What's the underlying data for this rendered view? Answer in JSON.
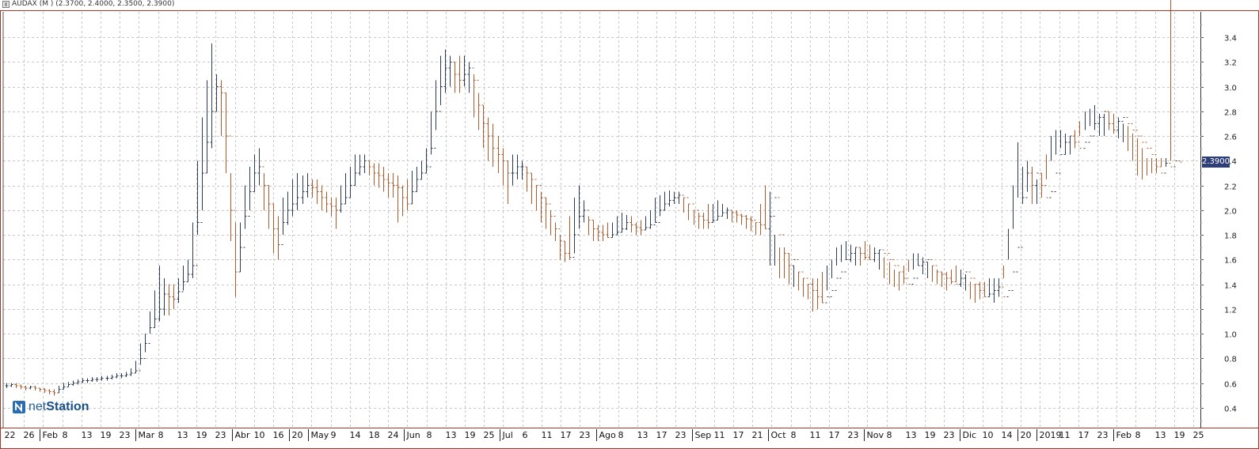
{
  "window": {
    "title": "AUDAX (M ) (2.3700, 2.4000, 2.3500, 2.3900)"
  },
  "logo": {
    "text_prefix": "net",
    "text_suffix": "Station",
    "icon": "netstation-logo-icon"
  },
  "colors": {
    "up": "#2b3a55",
    "down": "#b05a2c",
    "grid": "#c8c8c8",
    "frame": "#a03a2a",
    "badge": "#2e3f78"
  },
  "chart_data": {
    "type": "ohlc",
    "ylim": [
      0.3,
      3.6
    ],
    "yticks": [
      "0.4",
      "0.6",
      "0.8",
      "1.0",
      "1.2",
      "1.4",
      "1.6",
      "1.8",
      "2.0",
      "2.2",
      "2.4",
      "2.6",
      "2.8",
      "3.0",
      "3.2",
      "3.4"
    ],
    "last_price": "2.3900",
    "xticks": [
      "22",
      "26",
      "Feb",
      "8",
      "13",
      "19",
      "23",
      "Mar",
      "8",
      "13",
      "19",
      "23",
      "Abr",
      "10",
      "16",
      "20",
      "May",
      "9",
      "14",
      "18",
      "24",
      "Jun",
      "8",
      "13",
      "19",
      "25",
      "Jul",
      "6",
      "11",
      "17",
      "23",
      "Ago",
      "8",
      "13",
      "17",
      "23",
      "Sep",
      "11",
      "17",
      "21",
      "Oct",
      "8",
      "11",
      "17",
      "23",
      "Nov",
      "8",
      "13",
      "19",
      "23",
      "Dic",
      "10",
      "14",
      "20",
      "2019",
      "11",
      "17",
      "23",
      "Feb",
      "8",
      "13",
      "19",
      "25"
    ],
    "grid": true,
    "close": [
      0.58,
      0.59,
      0.58,
      0.57,
      0.56,
      0.57,
      0.56,
      0.55,
      0.54,
      0.53,
      0.52,
      0.55,
      0.57,
      0.59,
      0.6,
      0.61,
      0.62,
      0.62,
      0.63,
      0.63,
      0.64,
      0.64,
      0.65,
      0.66,
      0.66,
      0.67,
      0.68,
      0.7,
      0.8,
      0.92,
      1.05,
      1.12,
      1.2,
      1.32,
      1.3,
      1.28,
      1.34,
      1.42,
      1.48,
      1.55,
      1.9,
      2.3,
      2.55,
      2.8,
      3.0,
      2.95,
      2.6,
      2.0,
      1.5,
      1.7,
      1.95,
      2.15,
      2.3,
      2.35,
      2.2,
      2.05,
      1.85,
      1.72,
      1.9,
      2.0,
      2.05,
      2.1,
      2.15,
      2.2,
      2.18,
      2.15,
      2.1,
      2.05,
      2.03,
      2.0,
      2.05,
      2.1,
      2.2,
      2.3,
      2.35,
      2.4,
      2.35,
      2.3,
      2.28,
      2.25,
      2.22,
      2.2,
      2.18,
      2.1,
      2.05,
      2.15,
      2.25,
      2.3,
      2.35,
      2.5,
      2.8,
      3.0,
      3.15,
      3.2,
      3.1,
      3.05,
      3.1,
      3.15,
      3.05,
      2.85,
      2.7,
      2.6,
      2.5,
      2.45,
      2.4,
      2.3,
      2.3,
      2.35,
      2.35,
      2.3,
      2.25,
      2.2,
      2.1,
      2.05,
      1.95,
      1.85,
      1.75,
      1.65,
      1.62,
      1.8,
      1.95,
      2.0,
      1.92,
      1.85,
      1.82,
      1.8,
      1.78,
      1.8,
      1.82,
      1.85,
      1.9,
      1.88,
      1.86,
      1.84,
      1.86,
      1.88,
      1.9,
      2.0,
      2.05,
      2.08,
      2.1,
      2.12,
      2.1,
      2.05,
      2.0,
      1.95,
      1.92,
      1.9,
      1.92,
      1.95,
      1.98,
      2.0,
      1.98,
      1.96,
      1.95,
      1.93,
      1.92,
      1.9,
      1.88,
      1.85,
      1.95,
      2.1,
      1.8,
      1.65,
      1.55,
      1.6,
      1.5,
      1.45,
      1.4,
      1.35,
      1.3,
      1.25,
      1.3,
      1.35,
      1.45,
      1.5,
      1.6,
      1.65,
      1.7,
      1.65,
      1.62,
      1.6,
      1.65,
      1.68,
      1.65,
      1.6,
      1.55,
      1.5,
      1.45,
      1.4,
      1.45,
      1.55,
      1.58,
      1.6,
      1.55,
      1.5,
      1.48,
      1.45,
      1.42,
      1.4,
      1.45,
      1.5,
      1.45,
      1.4,
      1.35,
      1.3,
      1.32,
      1.35,
      1.38,
      1.3,
      1.35,
      1.5,
      1.7,
      2.1,
      2.3,
      2.2,
      2.3,
      2.2,
      2.1,
      2.15,
      2.3,
      2.45,
      2.55,
      2.6,
      2.55,
      2.5,
      2.55,
      2.6,
      2.7,
      2.75,
      2.8,
      2.7,
      2.65,
      2.72,
      2.75,
      2.7,
      2.65,
      2.6,
      2.55,
      2.5,
      2.45,
      2.35,
      2.3,
      2.38,
      2.35,
      2.4,
      2.39
    ],
    "high": [
      0.6,
      0.6,
      0.6,
      0.59,
      0.58,
      0.58,
      0.58,
      0.56,
      0.56,
      0.55,
      0.55,
      0.58,
      0.6,
      0.61,
      0.62,
      0.63,
      0.64,
      0.64,
      0.65,
      0.65,
      0.66,
      0.66,
      0.67,
      0.68,
      0.68,
      0.69,
      0.72,
      0.78,
      0.92,
      1.0,
      1.18,
      1.35,
      1.55,
      1.45,
      1.4,
      1.4,
      1.45,
      1.55,
      1.6,
      1.9,
      2.4,
      2.75,
      3.05,
      3.35,
      3.1,
      3.05,
      2.95,
      2.3,
      1.9,
      1.9,
      2.2,
      2.35,
      2.45,
      2.5,
      2.3,
      2.2,
      2.05,
      1.95,
      2.1,
      2.15,
      2.25,
      2.3,
      2.28,
      2.3,
      2.25,
      2.25,
      2.2,
      2.15,
      2.1,
      2.1,
      2.2,
      2.3,
      2.35,
      2.45,
      2.45,
      2.45,
      2.4,
      2.38,
      2.38,
      2.35,
      2.3,
      2.3,
      2.28,
      2.2,
      2.25,
      2.32,
      2.35,
      2.4,
      2.5,
      2.8,
      3.05,
      3.25,
      3.3,
      3.25,
      3.2,
      3.25,
      3.25,
      3.2,
      3.1,
      2.95,
      2.85,
      2.75,
      2.7,
      2.6,
      2.5,
      2.4,
      2.45,
      2.45,
      2.4,
      2.35,
      2.3,
      2.2,
      2.15,
      2.1,
      2.0,
      1.9,
      1.8,
      1.75,
      1.95,
      2.1,
      2.2,
      2.08,
      1.95,
      1.92,
      1.88,
      1.88,
      1.9,
      1.9,
      1.95,
      1.98,
      1.96,
      1.95,
      1.9,
      1.92,
      1.95,
      2.0,
      2.1,
      2.12,
      2.15,
      2.16,
      2.15,
      2.15,
      2.1,
      2.05,
      2.0,
      1.98,
      1.98,
      2.05,
      2.05,
      2.08,
      2.05,
      2.02,
      2.0,
      2.0,
      1.97,
      1.96,
      1.95,
      1.9,
      2.05,
      2.2,
      2.15,
      1.8,
      1.7,
      1.7,
      1.65,
      1.55,
      1.5,
      1.45,
      1.4,
      1.45,
      1.45,
      1.5,
      1.55,
      1.6,
      1.7,
      1.72,
      1.75,
      1.72,
      1.7,
      1.7,
      1.75,
      1.72,
      1.7,
      1.68,
      1.62,
      1.58,
      1.52,
      1.5,
      1.55,
      1.6,
      1.65,
      1.65,
      1.62,
      1.58,
      1.55,
      1.52,
      1.5,
      1.5,
      1.52,
      1.55,
      1.52,
      1.48,
      1.42,
      1.4,
      1.42,
      1.42,
      1.45,
      1.45,
      1.45,
      1.55,
      1.85,
      2.2,
      2.55,
      2.35,
      2.4,
      2.35,
      2.25,
      2.3,
      2.45,
      2.6,
      2.65,
      2.65,
      2.62,
      2.6,
      2.65,
      2.72,
      2.8,
      2.82,
      2.85,
      2.78,
      2.78,
      2.8,
      2.78,
      2.75,
      2.7,
      2.68,
      2.62,
      2.58,
      2.5,
      2.42,
      2.42,
      2.42,
      2.42,
      2.42,
      2.4
    ],
    "low": [
      0.56,
      0.57,
      0.56,
      0.55,
      0.54,
      0.55,
      0.54,
      0.53,
      0.52,
      0.51,
      0.5,
      0.52,
      0.55,
      0.57,
      0.58,
      0.59,
      0.6,
      0.6,
      0.61,
      0.61,
      0.62,
      0.62,
      0.63,
      0.64,
      0.64,
      0.65,
      0.66,
      0.68,
      0.75,
      0.85,
      1.0,
      1.05,
      1.1,
      1.15,
      1.15,
      1.2,
      1.25,
      1.35,
      1.42,
      1.45,
      1.8,
      2.0,
      2.3,
      2.5,
      2.8,
      2.6,
      2.3,
      1.75,
      1.3,
      1.5,
      1.85,
      2.0,
      2.15,
      2.2,
      2.0,
      1.85,
      1.65,
      1.6,
      1.8,
      1.88,
      1.95,
      2.0,
      2.05,
      2.1,
      2.1,
      2.05,
      2.0,
      1.98,
      1.95,
      1.85,
      1.98,
      2.05,
      2.1,
      2.2,
      2.28,
      2.3,
      2.28,
      2.2,
      2.18,
      2.15,
      2.1,
      2.1,
      1.9,
      1.95,
      2.0,
      2.05,
      2.15,
      2.25,
      2.3,
      2.45,
      2.65,
      2.85,
      2.95,
      3.0,
      2.95,
      2.95,
      3.0,
      2.95,
      2.75,
      2.65,
      2.5,
      2.4,
      2.35,
      2.3,
      2.2,
      2.05,
      2.2,
      2.25,
      2.25,
      2.15,
      2.05,
      2.0,
      1.9,
      1.85,
      1.8,
      1.75,
      1.6,
      1.58,
      1.6,
      1.65,
      1.85,
      1.9,
      1.8,
      1.75,
      1.75,
      1.75,
      1.78,
      1.78,
      1.8,
      1.82,
      1.84,
      1.82,
      1.8,
      1.8,
      1.84,
      1.85,
      1.9,
      1.95,
      2.0,
      2.03,
      2.05,
      2.05,
      1.98,
      1.92,
      1.88,
      1.85,
      1.85,
      1.85,
      1.9,
      1.92,
      1.95,
      1.93,
      1.9,
      1.9,
      1.88,
      1.85,
      1.83,
      1.8,
      1.8,
      1.85,
      1.55,
      1.55,
      1.45,
      1.45,
      1.4,
      1.38,
      1.35,
      1.3,
      1.28,
      1.18,
      1.2,
      1.25,
      1.35,
      1.45,
      1.55,
      1.58,
      1.6,
      1.58,
      1.55,
      1.55,
      1.6,
      1.6,
      1.58,
      1.52,
      1.45,
      1.4,
      1.38,
      1.35,
      1.4,
      1.5,
      1.52,
      1.55,
      1.48,
      1.45,
      1.42,
      1.4,
      1.38,
      1.35,
      1.4,
      1.42,
      1.38,
      1.35,
      1.28,
      1.25,
      1.28,
      1.3,
      1.3,
      1.25,
      1.3,
      1.45,
      1.6,
      1.85,
      2.1,
      2.05,
      2.15,
      2.05,
      2.05,
      2.1,
      2.25,
      2.4,
      2.45,
      2.5,
      2.45,
      2.45,
      2.5,
      2.6,
      2.65,
      2.68,
      2.65,
      2.6,
      2.6,
      2.65,
      2.62,
      2.58,
      2.55,
      2.48,
      2.4,
      2.28,
      2.25,
      2.28,
      2.3,
      2.3,
      2.35,
      2.35
    ]
  }
}
